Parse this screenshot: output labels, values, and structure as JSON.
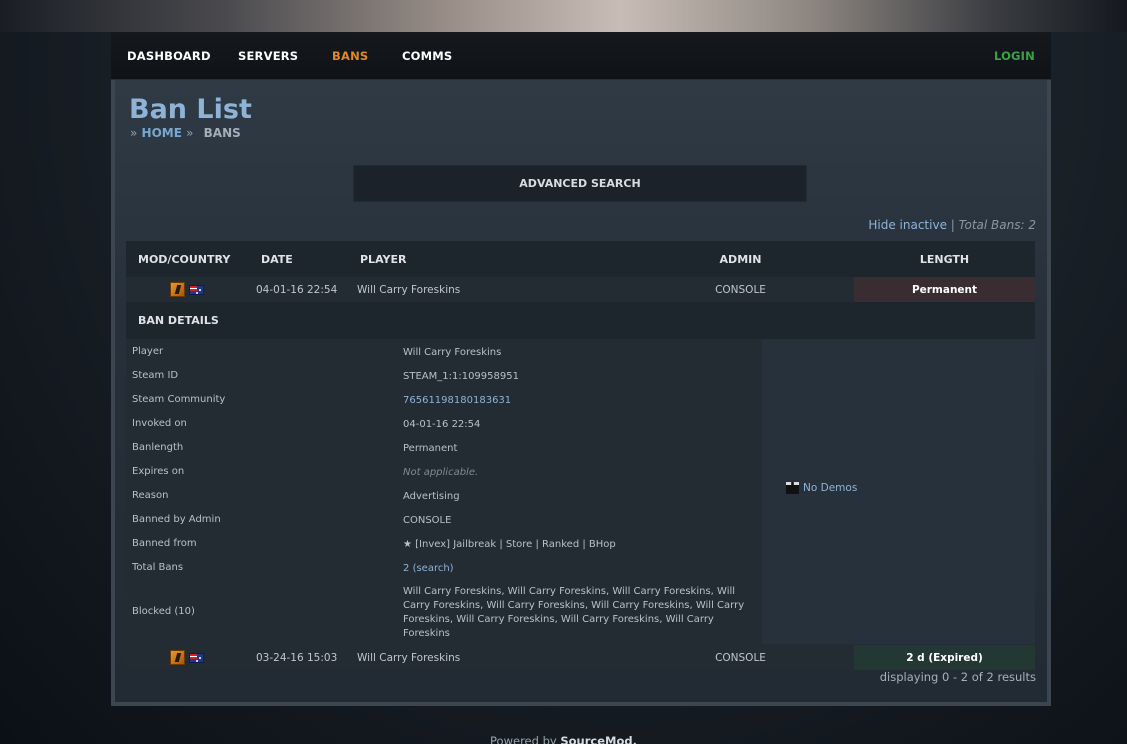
{
  "nav": {
    "items": [
      {
        "label": "DASHBOARD"
      },
      {
        "label": "SERVERS"
      },
      {
        "label": "BANS"
      },
      {
        "label": "COMMS"
      }
    ],
    "login": "LOGIN",
    "active_color": "#e08a1e",
    "login_color": "#3aa34a"
  },
  "page": {
    "title": "Ban List",
    "breadcrumb": {
      "sep": "»",
      "home": "HOME",
      "current": "BANS"
    }
  },
  "search": {
    "advanced_label": "ADVANCED SEARCH"
  },
  "toolbar": {
    "hide_inactive": "Hide inactive",
    "divider": "|",
    "total_bans": "Total Bans: 2"
  },
  "table": {
    "headers": {
      "mod_country": "MOD/COUNTRY",
      "date": "DATE",
      "player": "PLAYER",
      "admin": "ADMIN",
      "length": "LENGTH"
    },
    "rows": [
      {
        "game_icon": "csgo-icon",
        "flag_icon": "australia-flag-icon",
        "date": "04-01-16 22:54",
        "player": "Will Carry Foreskins",
        "admin": "CONSOLE",
        "length": "Permanent",
        "status_color": "#3a2d31"
      },
      {
        "game_icon": "csgo-icon",
        "flag_icon": "australia-flag-icon",
        "date": "03-24-16 15:03",
        "player": "Will Carry Foreskins",
        "admin": "CONSOLE",
        "length": "2 d (Expired)",
        "status_color": "#233833"
      }
    ]
  },
  "details": {
    "title": "BAN DETAILS",
    "fields": {
      "player": {
        "label": "Player",
        "value": "Will Carry Foreskins"
      },
      "steam_id": {
        "label": "Steam ID",
        "value": "STEAM_1:1:109958951"
      },
      "steam_community": {
        "label": "Steam Community",
        "value": "76561198180183631"
      },
      "invoked_on": {
        "label": "Invoked on",
        "value": "04-01-16 22:54"
      },
      "banlength": {
        "label": "Banlength",
        "value": "Permanent"
      },
      "expires_on": {
        "label": "Expires on",
        "value": "Not applicable."
      },
      "reason": {
        "label": "Reason",
        "value": "Advertising"
      },
      "banned_by": {
        "label": "Banned by Admin",
        "value": "CONSOLE"
      },
      "banned_from": {
        "label": "Banned from",
        "value": "★ [Invex] Jailbreak | Store | Ranked | BHop"
      },
      "total_bans": {
        "label": "Total Bans",
        "value": "2",
        "search_link": "(search)"
      },
      "blocked": {
        "label": "Blocked (10)",
        "value": "Will Carry Foreskins, Will Carry Foreskins, Will Carry Foreskins, Will Carry Foreskins, Will Carry Foreskins, Will Carry Foreskins, Will Carry Foreskins, Will Carry Foreskins, Will Carry Foreskins, Will Carry Foreskins"
      }
    },
    "demos": "No Demos"
  },
  "pagination": {
    "text": "displaying 0 - 2 of 2 results"
  },
  "footer": {
    "prefix": "Powered by",
    "brand": "SourceMod."
  }
}
